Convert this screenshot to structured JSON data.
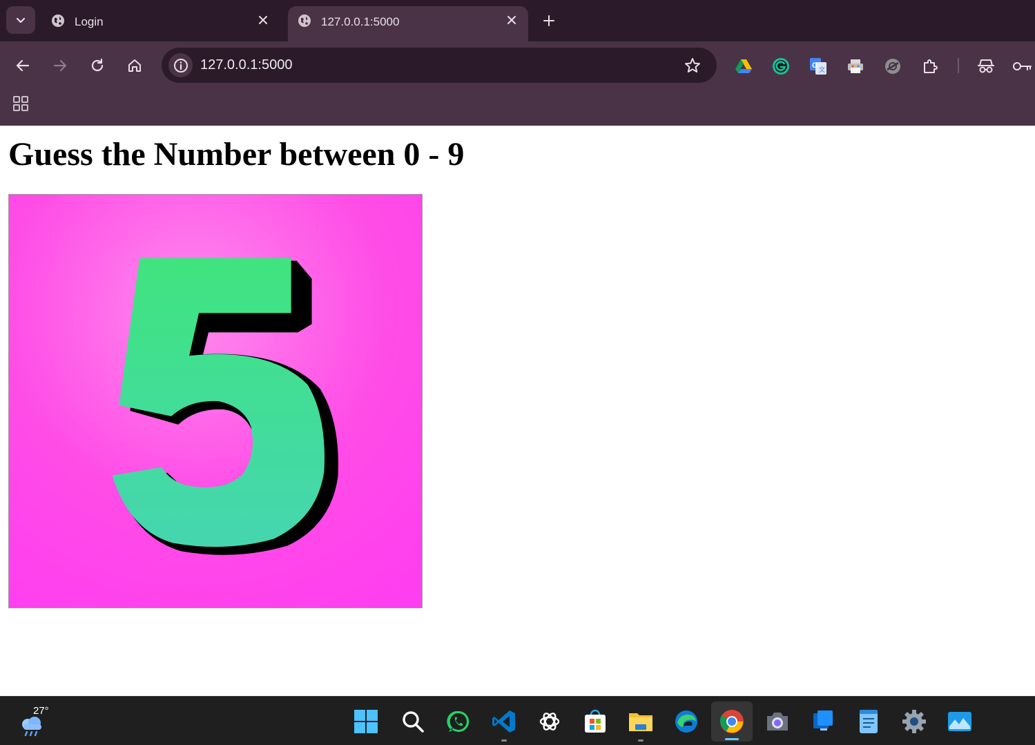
{
  "browser": {
    "tabs": [
      {
        "title": "Login",
        "active": false
      },
      {
        "title": "127.0.0.1:5000",
        "active": true
      }
    ],
    "omnibox": {
      "url": "127.0.0.1:5000"
    },
    "extensions": [
      "google-drive-icon",
      "grammarly-icon",
      "google-translate-icon",
      "printer-icon",
      "blocked-extension-icon",
      "extensions-puzzle-icon",
      "incognito-icon",
      "password-key-icon"
    ]
  },
  "page": {
    "heading": "Guess the Number between 0 - 9",
    "image": {
      "digit": "5",
      "background_top": "#ff8aee",
      "background_bottom": "#ff3ef0",
      "digit_color": "#3ddf8a"
    }
  },
  "taskbar": {
    "weather": {
      "temperature": "27°"
    },
    "apps": [
      "windows-start-icon",
      "search-icon",
      "whatsapp-icon",
      "vscode-icon",
      "chatgpt-icon",
      "microsoft-store-icon",
      "file-explorer-icon",
      "edge-icon",
      "chrome-icon",
      "camera-icon",
      "windows-app-icon",
      "notepad-icon",
      "settings-icon",
      "photos-icon"
    ]
  },
  "colors": {
    "titlebar": "#2b1b2a",
    "toolbar": "#4a3347",
    "taskbar": "#1f1f1f"
  }
}
